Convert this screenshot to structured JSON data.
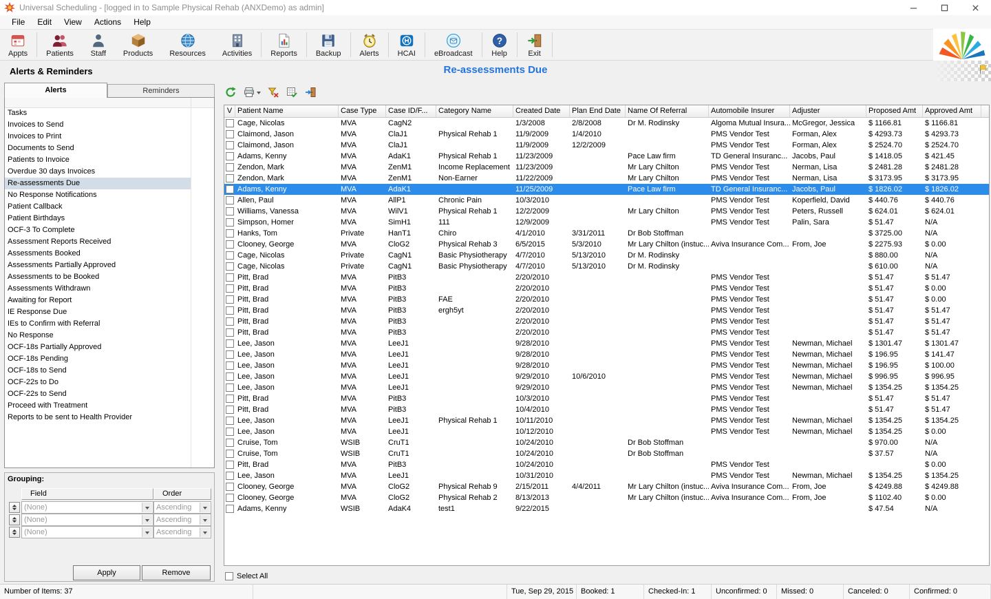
{
  "colors": {
    "accent_blue": "#2374dd",
    "selection_blue": "#2b8ceb",
    "sidebar_selection": "#d3dde8"
  },
  "window": {
    "title": "Universal Scheduling - [logged in to Sample Physical Rehab (ANXDemo) as admin]"
  },
  "menu": {
    "items": [
      "File",
      "Edit",
      "View",
      "Actions",
      "Help"
    ]
  },
  "toolbar": {
    "buttons": [
      {
        "label": "Appts",
        "icon": "appointments-icon"
      },
      {
        "label": "Patients",
        "icon": "patients-icon"
      },
      {
        "label": "Staff",
        "icon": "staff-icon"
      },
      {
        "label": "Products",
        "icon": "products-icon"
      },
      {
        "label": "Resources",
        "icon": "resources-icon"
      },
      {
        "label": "Activities",
        "icon": "activities-icon"
      },
      {
        "label": "Reports",
        "icon": "reports-icon"
      },
      {
        "label": "Backup",
        "icon": "backup-icon"
      },
      {
        "label": "Alerts",
        "icon": "alerts-icon"
      },
      {
        "label": "HCAI",
        "icon": "hcai-icon"
      },
      {
        "label": "eBroadcast",
        "icon": "ebroadcast-icon"
      },
      {
        "label": "Help",
        "icon": "help-icon"
      },
      {
        "label": "Exit",
        "icon": "exit-icon"
      }
    ]
  },
  "header": {
    "section_title": "Alerts & Reminders",
    "page_title": "Re-assessments Due"
  },
  "sidebar": {
    "tabs": [
      {
        "label": "Alerts",
        "active": true
      },
      {
        "label": "Reminders",
        "active": false
      }
    ],
    "items": [
      "Tasks",
      "Invoices to Send",
      "Invoices to Print",
      "Documents to Send",
      "Patients to Invoice",
      "Overdue 30 days Invoices",
      "Re-assessments Due",
      "No Response Notifications",
      "Patient Callback",
      "Patient Birthdays",
      "OCF-3 To Complete",
      "Assessment Reports Received",
      "Assessments Booked",
      "Assessments Partially Approved",
      "Assessments to be Booked",
      "Assessments Withdrawn",
      "Awaiting for Report",
      "IE Response Due",
      "IEs to Confirm with Referral",
      "No Response",
      "OCF-18s Partially Approved",
      "OCF-18s Pending",
      "OCF-18s to Send",
      "OCF-22s to Do",
      "OCF-22s to Send",
      "Proceed with Treatment",
      "Reports to be sent to Health Provider"
    ],
    "selected_index": 6,
    "grouping": {
      "title": "Grouping:",
      "columns": [
        "Field",
        "Order"
      ],
      "rows": [
        {
          "field": "(None)",
          "order": "Ascending"
        },
        {
          "field": "(None)",
          "order": "Ascending"
        },
        {
          "field": "(None)",
          "order": "Ascending"
        }
      ],
      "apply_label": "Apply",
      "remove_label": "Remove"
    }
  },
  "grid_toolbar": {
    "buttons": [
      {
        "name": "refresh",
        "icon": "refresh-icon"
      },
      {
        "name": "print",
        "icon": "print-icon",
        "has_dropdown": true
      },
      {
        "name": "alert-settings",
        "icon": "alert-filter-icon"
      },
      {
        "name": "export",
        "icon": "export-icon"
      },
      {
        "name": "close-panel",
        "icon": "close-panel-icon"
      }
    ]
  },
  "grid": {
    "columns": [
      "V",
      "Patient Name",
      "Case Type",
      "Case ID/F...",
      "Category Name",
      "Created Date",
      "Plan End Date",
      "Name Of Referral",
      "Automobile Insurer",
      "Adjuster",
      "Proposed Amt",
      "Approved Amt"
    ],
    "selected_row_index": 6,
    "select_all_label": "Select All",
    "rows": [
      [
        "Cage, Nicolas",
        "MVA",
        "CagN2",
        "",
        "1/3/2008",
        "2/8/2008",
        "Dr M. Rodinsky",
        "Algoma Mutual Insura...",
        "McGregor, Jessica",
        "$ 1166.81",
        "$ 1166.81"
      ],
      [
        "Claimond, Jason",
        "MVA",
        "ClaJ1",
        "Physical Rehab 1",
        "11/9/2009",
        "1/4/2010",
        "",
        "PMS Vendor Test",
        "Forman, Alex",
        "$ 4293.73",
        "$ 4293.73"
      ],
      [
        "Claimond, Jason",
        "MVA",
        "ClaJ1",
        "",
        "11/9/2009",
        "12/2/2009",
        "",
        "PMS Vendor Test",
        "Forman, Alex",
        "$ 2524.70",
        "$ 2524.70"
      ],
      [
        "Adams, Kenny",
        "MVA",
        "AdaK1",
        "Physical Rehab 1",
        "11/23/2009",
        "",
        "Pace Law firm",
        "TD General Insuranc...",
        "Jacobs, Paul",
        "$ 1418.05",
        "$ 421.45"
      ],
      [
        "Zendon, Mark",
        "MVA",
        "ZenM1",
        "Income Replacement",
        "11/23/2009",
        "",
        "Mr Lary Chilton",
        "PMS Vendor Test",
        "Nerman, Lisa",
        "$ 2481.28",
        "$ 2481.28"
      ],
      [
        "Zendon, Mark",
        "MVA",
        "ZenM1",
        "Non-Earner",
        "11/22/2009",
        "",
        "Mr Lary Chilton",
        "PMS Vendor Test",
        "Nerman, Lisa",
        "$ 3173.95",
        "$ 3173.95"
      ],
      [
        "Adams, Kenny",
        "MVA",
        "AdaK1",
        "",
        "11/25/2009",
        "",
        "Pace Law firm",
        "TD General Insuranc...",
        "Jacobs, Paul",
        "$ 1826.02",
        "$ 1826.02"
      ],
      [
        "Allen, Paul",
        "MVA",
        "AllP1",
        "Chronic Pain",
        "10/3/2010",
        "",
        "",
        "PMS Vendor Test",
        "Koperfield, David",
        "$ 440.76",
        "$ 440.76"
      ],
      [
        "Williams, Vanessa",
        "MVA",
        "WilV1",
        "Physical Rehab 1",
        "12/2/2009",
        "",
        "Mr Lary Chilton",
        "PMS Vendor Test",
        "Peters, Russell",
        "$ 624.01",
        "$ 624.01"
      ],
      [
        "Simpson, Homer",
        "MVA",
        "SimH1",
        "111",
        "12/9/2009",
        "",
        "",
        "PMS Vendor Test",
        "Palin, Sara",
        "$ 51.47",
        "N/A"
      ],
      [
        "Hanks, Tom",
        "Private",
        "HanT1",
        "Chiro",
        "4/1/2010",
        "3/31/2011",
        "Dr Bob Stoffman",
        "",
        "",
        "$ 3725.00",
        "N/A"
      ],
      [
        "Clooney, George",
        "MVA",
        "CloG2",
        "Physical Rehab 3",
        "6/5/2015",
        "5/3/2010",
        "Mr Lary Chilton (instuc...",
        "Aviva Insurance Com...",
        "From, Joe",
        "$ 2275.93",
        "$ 0.00"
      ],
      [
        "Cage, Nicolas",
        "Private",
        "CagN1",
        "Basic Physiotherapy",
        "4/7/2010",
        "5/13/2010",
        "Dr M. Rodinsky",
        "",
        "",
        "$ 880.00",
        "N/A"
      ],
      [
        "Cage, Nicolas",
        "Private",
        "CagN1",
        "Basic Physiotherapy",
        "4/7/2010",
        "5/13/2010",
        "Dr M. Rodinsky",
        "",
        "",
        "$ 610.00",
        "N/A"
      ],
      [
        "Pitt, Brad",
        "MVA",
        "PitB3",
        "",
        "2/20/2010",
        "",
        "",
        "PMS Vendor Test",
        "",
        "$ 51.47",
        "$ 51.47"
      ],
      [
        "Pitt, Brad",
        "MVA",
        "PitB3",
        "",
        "2/20/2010",
        "",
        "",
        "PMS Vendor Test",
        "",
        "$ 51.47",
        "$ 0.00"
      ],
      [
        "Pitt, Brad",
        "MVA",
        "PitB3",
        "FAE",
        "2/20/2010",
        "",
        "",
        "PMS Vendor Test",
        "",
        "$ 51.47",
        "$ 0.00"
      ],
      [
        "Pitt, Brad",
        "MVA",
        "PitB3",
        "ergh5yt",
        "2/20/2010",
        "",
        "",
        "PMS Vendor Test",
        "",
        "$ 51.47",
        "$ 51.47"
      ],
      [
        "Pitt, Brad",
        "MVA",
        "PitB3",
        "",
        "2/20/2010",
        "",
        "",
        "PMS Vendor Test",
        "",
        "$ 51.47",
        "$ 51.47"
      ],
      [
        "Pitt, Brad",
        "MVA",
        "PitB3",
        "",
        "2/20/2010",
        "",
        "",
        "PMS Vendor Test",
        "",
        "$ 51.47",
        "$ 51.47"
      ],
      [
        "Lee, Jason",
        "MVA",
        "LeeJ1",
        "",
        "9/28/2010",
        "",
        "",
        "PMS Vendor Test",
        "Newman, Michael",
        "$ 1301.47",
        "$ 1301.47"
      ],
      [
        "Lee, Jason",
        "MVA",
        "LeeJ1",
        "",
        "9/28/2010",
        "",
        "",
        "PMS Vendor Test",
        "Newman, Michael",
        "$ 196.95",
        "$ 141.47"
      ],
      [
        "Lee, Jason",
        "MVA",
        "LeeJ1",
        "",
        "9/28/2010",
        "",
        "",
        "PMS Vendor Test",
        "Newman, Michael",
        "$ 196.95",
        "$ 100.00"
      ],
      [
        "Lee, Jason",
        "MVA",
        "LeeJ1",
        "",
        "9/29/2010",
        "10/6/2010",
        "",
        "PMS Vendor Test",
        "Newman, Michael",
        "$ 996.95",
        "$ 996.95"
      ],
      [
        "Lee, Jason",
        "MVA",
        "LeeJ1",
        "",
        "9/29/2010",
        "",
        "",
        "PMS Vendor Test",
        "Newman, Michael",
        "$ 1354.25",
        "$ 1354.25"
      ],
      [
        "Pitt, Brad",
        "MVA",
        "PitB3",
        "",
        "10/3/2010",
        "",
        "",
        "PMS Vendor Test",
        "",
        "$ 51.47",
        "$ 51.47"
      ],
      [
        "Pitt, Brad",
        "MVA",
        "PitB3",
        "",
        "10/4/2010",
        "",
        "",
        "PMS Vendor Test",
        "",
        "$ 51.47",
        "$ 51.47"
      ],
      [
        "Lee, Jason",
        "MVA",
        "LeeJ1",
        "Physical Rehab 1",
        "10/11/2010",
        "",
        "",
        "PMS Vendor Test",
        "Newman, Michael",
        "$ 1354.25",
        "$ 1354.25"
      ],
      [
        "Lee, Jason",
        "MVA",
        "LeeJ1",
        "",
        "10/12/2010",
        "",
        "",
        "PMS Vendor Test",
        "Newman, Michael",
        "$ 1354.25",
        "$ 0.00"
      ],
      [
        "Cruise, Tom",
        "WSIB",
        "CruT1",
        "",
        "10/24/2010",
        "",
        "Dr Bob Stoffman",
        "",
        "",
        "$ 970.00",
        "N/A"
      ],
      [
        "Cruise, Tom",
        "WSIB",
        "CruT1",
        "",
        "10/24/2010",
        "",
        "Dr Bob Stoffman",
        "",
        "",
        "$ 37.57",
        "N/A"
      ],
      [
        "Pitt, Brad",
        "MVA",
        "PitB3",
        "",
        "10/24/2010",
        "",
        "",
        "PMS Vendor Test",
        "",
        "",
        "$ 0.00"
      ],
      [
        "Lee, Jason",
        "MVA",
        "LeeJ1",
        "",
        "10/31/2010",
        "",
        "",
        "PMS Vendor Test",
        "Newman, Michael",
        "$ 1354.25",
        "$ 1354.25"
      ],
      [
        "Clooney, George",
        "MVA",
        "CloG2",
        "Physical Rehab 9",
        "2/15/2011",
        "4/4/2011",
        "Mr Lary Chilton (instuc...",
        "Aviva Insurance Com...",
        "From, Joe",
        "$ 4249.88",
        "$ 4249.88"
      ],
      [
        "Clooney, George",
        "MVA",
        "CloG2",
        "Physical Rehab 2",
        "8/13/2013",
        "",
        "Mr Lary Chilton (instuc...",
        "Aviva Insurance Com...",
        "From, Joe",
        "$ 1102.40",
        "$ 0.00"
      ],
      [
        "Adams, Kenny",
        "WSIB",
        "AdaK4",
        "test1",
        "9/22/2015",
        "",
        "",
        "",
        "",
        "$ 47.54",
        "N/A"
      ]
    ]
  },
  "statusbar": {
    "segments": [
      "Number of Items: 37",
      "",
      "Tue, Sep 29, 2015",
      "Booked: 1",
      "Checked-In: 1",
      "Unconfirmed: 0",
      "Missed: 0",
      "Canceled: 0",
      "Confirmed: 0"
    ]
  }
}
